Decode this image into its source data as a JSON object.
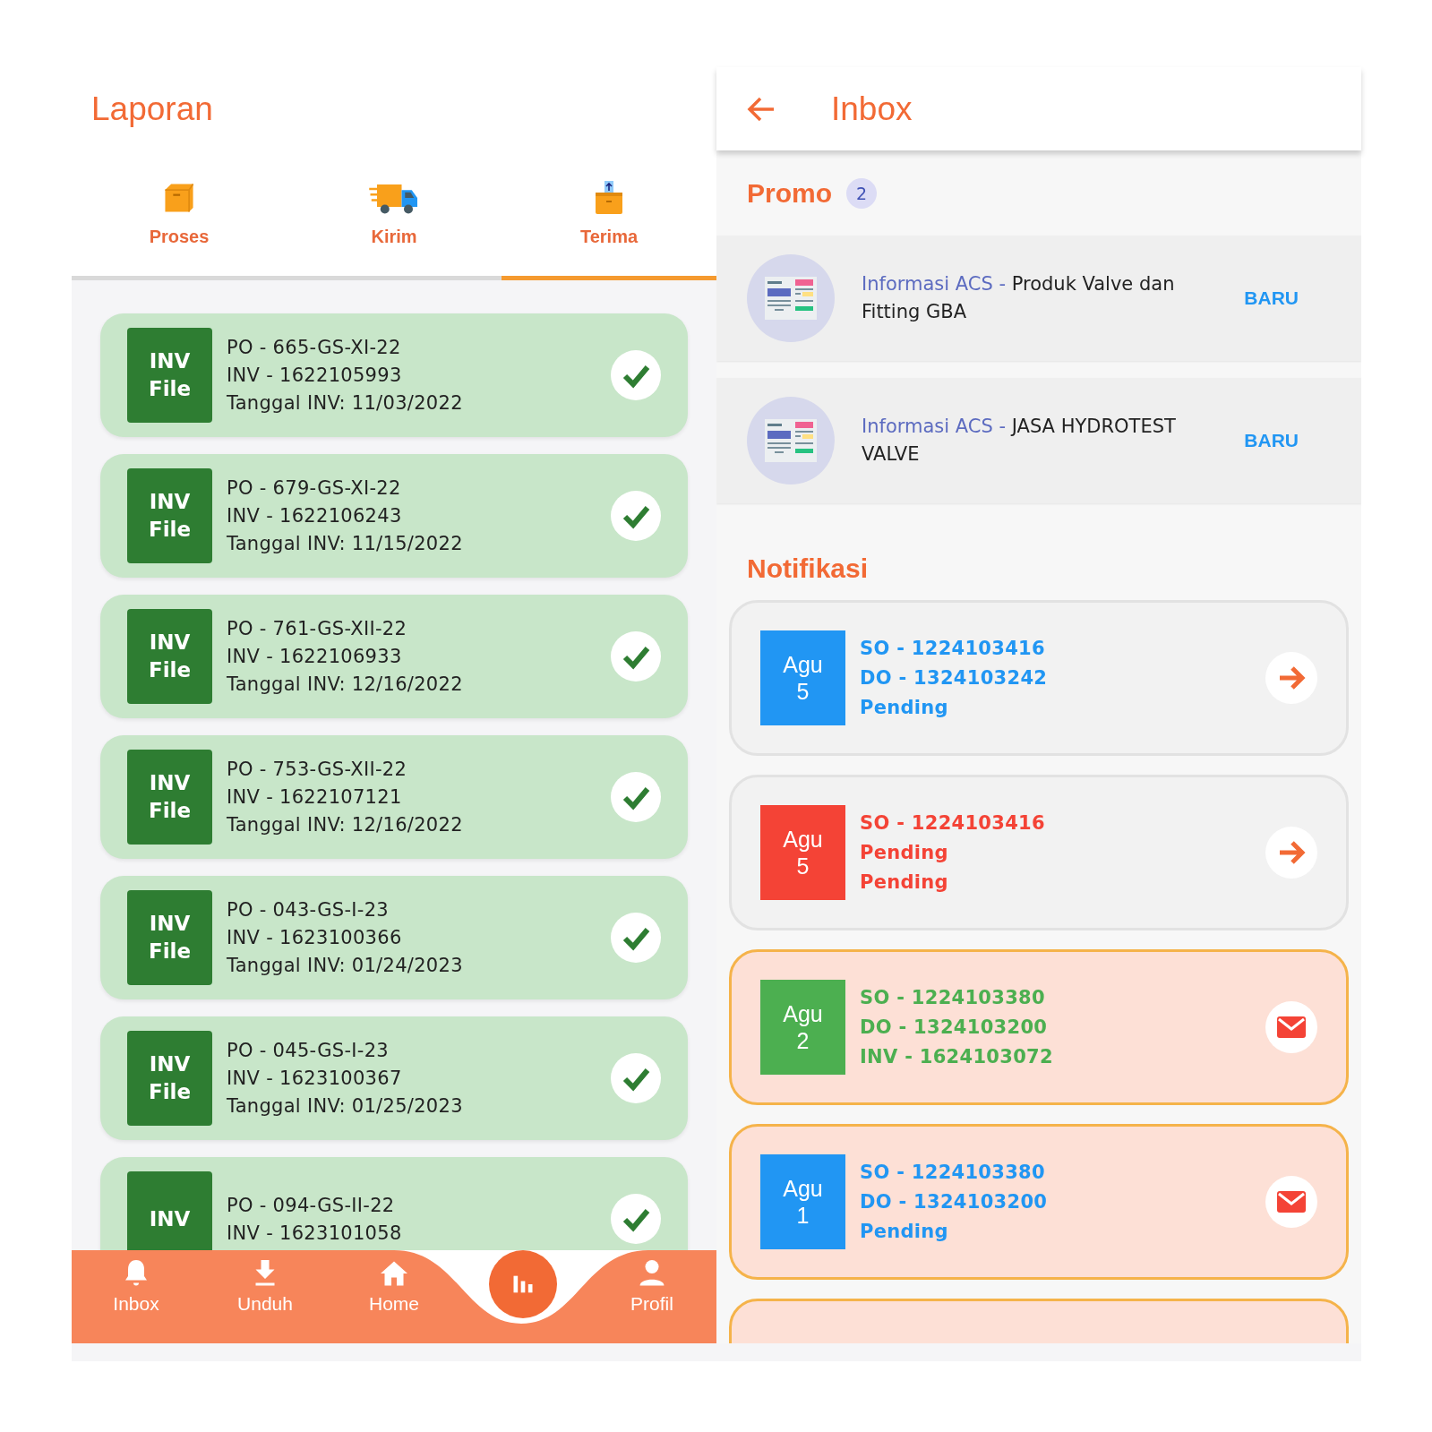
{
  "left": {
    "title": "Laporan",
    "tabs": [
      {
        "label": "Proses",
        "kind": "box",
        "selected": false
      },
      {
        "label": "Kirim",
        "kind": "truck",
        "selected": false
      },
      {
        "label": "Terima",
        "kind": "receive",
        "selected": true
      }
    ],
    "invoices": [
      {
        "badge_top": "INV",
        "badge_bottom": "File",
        "po": "PO - 665-GS-XI-22",
        "inv": "INV - 1622105993",
        "date": "Tanggal INV: 11/03/2022",
        "checked": true
      },
      {
        "badge_top": "INV",
        "badge_bottom": "File",
        "po": "PO - 679-GS-XI-22",
        "inv": "INV - 1622106243",
        "date": "Tanggal INV: 11/15/2022",
        "checked": true
      },
      {
        "badge_top": "INV",
        "badge_bottom": "File",
        "po": "PO - 761-GS-XII-22",
        "inv": "INV - 1622106933",
        "date": "Tanggal INV: 12/16/2022",
        "checked": true
      },
      {
        "badge_top": "INV",
        "badge_bottom": "File",
        "po": "PO - 753-GS-XII-22",
        "inv": "INV - 1622107121",
        "date": "Tanggal INV: 12/16/2022",
        "checked": true
      },
      {
        "badge_top": "INV",
        "badge_bottom": "File",
        "po": "PO - 043-GS-I-23",
        "inv": "INV - 1623100366",
        "date": "Tanggal INV: 01/24/2023",
        "checked": true
      },
      {
        "badge_top": "INV",
        "badge_bottom": "File",
        "po": "PO - 045-GS-I-23",
        "inv": "INV - 1623100367",
        "date": "Tanggal INV: 01/25/2023",
        "checked": true
      },
      {
        "badge_top": "INV",
        "po": "PO - 094-GS-II-22",
        "inv": "INV - 1623101058",
        "checked": true
      }
    ],
    "nav": [
      {
        "label": "Inbox",
        "kind": "bell"
      },
      {
        "label": "Unduh",
        "kind": "download"
      },
      {
        "label": "Home",
        "kind": "home"
      },
      {
        "kind": "center"
      },
      {
        "label": "Profil",
        "kind": "person"
      }
    ]
  },
  "right": {
    "title": "Inbox",
    "promo": {
      "heading": "Promo",
      "count": "2",
      "items": [
        {
          "source": "Informasi ACS -",
          "title": "Produk Valve dan Fitting GBA",
          "badge": "BARU"
        },
        {
          "source": "Informasi ACS -",
          "title": "JASA HYDROTEST VALVE",
          "badge": "BARU"
        }
      ]
    },
    "notifications": {
      "heading": "Notifikasi",
      "items": [
        {
          "month": "Agu",
          "day": "5",
          "color": "#2196f3",
          "lines": [
            "SO - 1224103416",
            "DO - 1324103242",
            "Pending"
          ],
          "unread": false
        },
        {
          "month": "Agu",
          "day": "5",
          "color": "#f44336",
          "lines": [
            "SO - 1224103416",
            "Pending",
            "Pending"
          ],
          "unread": false
        },
        {
          "month": "Agu",
          "day": "2",
          "color": "#4caf50",
          "lines": [
            "SO - 1224103380",
            "DO - 1324103200",
            "INV - 1624103072"
          ],
          "unread": true
        },
        {
          "month": "Agu",
          "day": "1",
          "color": "#2196f3",
          "lines": [
            "SO - 1224103380",
            "DO - 1324103200",
            "Pending"
          ],
          "unread": true
        },
        {
          "unread": true
        }
      ]
    }
  }
}
